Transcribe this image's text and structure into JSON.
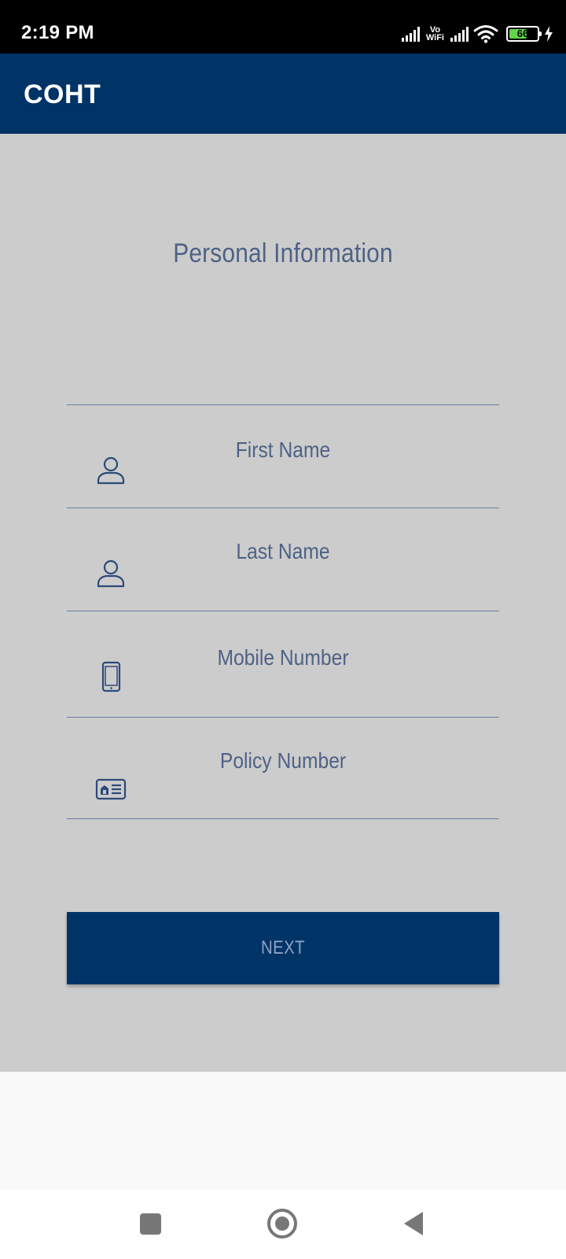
{
  "status_bar": {
    "time": "2:19 PM",
    "network_label_top": "Vo",
    "network_label_bottom": "WiFi",
    "battery_level": "66",
    "battery_fraction": 0.66
  },
  "app_bar": {
    "title": "COHT"
  },
  "form": {
    "title": "Personal Information",
    "fields": [
      {
        "placeholder": "First Name",
        "icon": "person-icon"
      },
      {
        "placeholder": "Last Name",
        "icon": "person-icon"
      },
      {
        "placeholder": "Mobile Number",
        "icon": "mobile-phone-icon"
      },
      {
        "placeholder": "Policy Number",
        "icon": "id-card-icon"
      }
    ],
    "next_label": "NEXT"
  },
  "colors": {
    "primary": "#003366",
    "background": "#cccccc",
    "text": "#4d6285"
  }
}
